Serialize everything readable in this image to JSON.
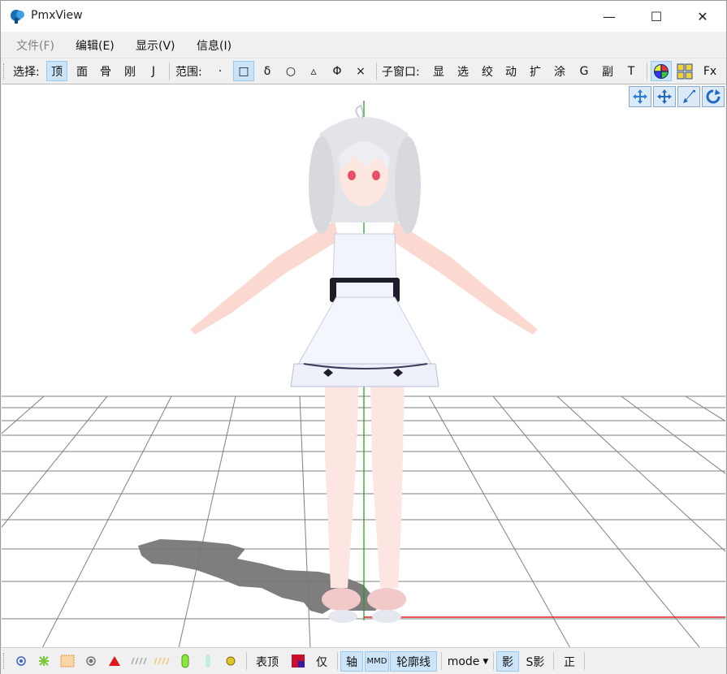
{
  "window": {
    "title": "PmxView",
    "minimize_glyph": "—",
    "maximize_glyph": "☐",
    "close_glyph": "✕"
  },
  "menu": {
    "items": [
      {
        "label": "文件(F)",
        "disabled": true
      },
      {
        "label": "编辑(E)",
        "disabled": false
      },
      {
        "label": "显示(V)",
        "disabled": false
      },
      {
        "label": "信息(I)",
        "disabled": false
      }
    ]
  },
  "toolbar": {
    "select_label": "选择:",
    "select_buttons": [
      "顶",
      "面",
      "骨",
      "刚",
      "J"
    ],
    "select_active": "顶",
    "range_label": "范围:",
    "range_buttons": [
      "·",
      "□",
      "δ",
      "○",
      "▵",
      "Φ",
      "×"
    ],
    "range_active": "□",
    "subwindow_label": "子窗口:",
    "subwindow_buttons": [
      "显",
      "选",
      "绞",
      "动",
      "扩",
      "涂",
      "G",
      "副",
      "T"
    ],
    "fx_label": "Fx"
  },
  "viewport": {
    "colors": {
      "grid": "#7f7f7f",
      "axis_y": "#1a9a1a",
      "axis_x": "#e02020",
      "shadow": "#777777"
    },
    "view_controls": [
      "move-view-icon",
      "pan-view-icon",
      "zoom-view-icon",
      "rotate-view-icon"
    ]
  },
  "bottombar": {
    "icons": [
      "vertex-icon",
      "mesh-icon",
      "texture-icon",
      "bone-icon",
      "triangle-icon",
      "weight-icon",
      "morph-icon",
      "rigid-icon",
      "joint-icon",
      "physics-icon"
    ],
    "morph_label": "表顶",
    "only_label": "仅",
    "axis_label": "轴",
    "mmd_label": "MMD",
    "outline_label": "轮廓线",
    "mode_label": "mode",
    "shadow_label": "影",
    "self_shadow_label": "S影",
    "front_label": "正"
  }
}
